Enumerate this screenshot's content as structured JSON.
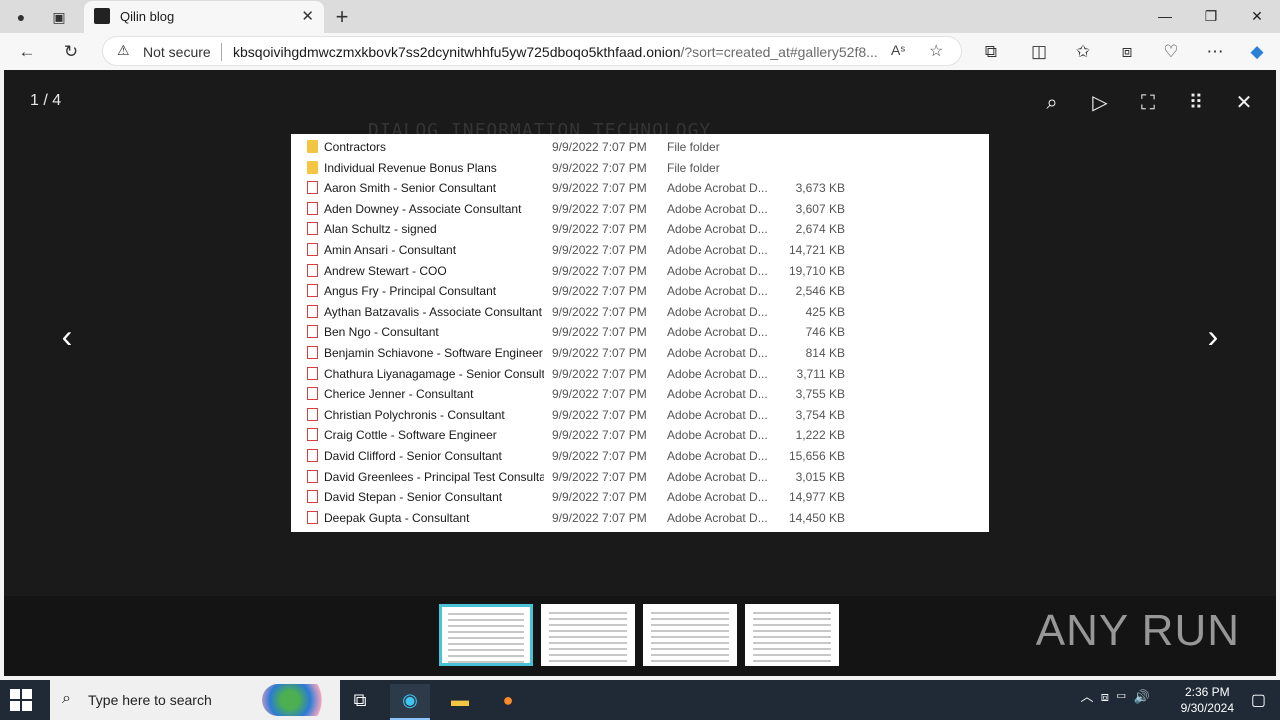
{
  "browser": {
    "tab_title": "Qilin blog",
    "security_label": "Not secure",
    "url_main": "kbsqoivihgdmwczmxkbovk7ss2dcynitwhhfu5yw725dboqo5kthfaad.onion",
    "url_rest": "/?sort=created_at#gallery52f8...",
    "icons": [
      "profile-icon",
      "tab-actions-icon",
      "close-icon",
      "new-tab-icon",
      "minimize-icon",
      "maximize-icon",
      "close-window-icon",
      "back-icon",
      "refresh-icon",
      "warning-icon",
      "read-aloud-icon",
      "favorite-icon",
      "extensions-icon",
      "split-screen-icon",
      "favorites-icon",
      "collections-icon",
      "browser-essentials-icon",
      "more-icon",
      "copilot-icon"
    ]
  },
  "background": {
    "title": "DIALOG INFORMATION TECHNOLOGY"
  },
  "lightbox": {
    "counter": "1 / 4",
    "controls": [
      "zoom-icon",
      "play-icon",
      "fullscreen-icon",
      "grid-icon",
      "close-icon"
    ],
    "files": [
      {
        "name": "Contractors",
        "date": "9/9/2022 7:07 PM",
        "type": "File folder",
        "size": "",
        "icon": "folder"
      },
      {
        "name": "Individual Revenue Bonus Plans",
        "date": "9/9/2022 7:07 PM",
        "type": "File folder",
        "size": "",
        "icon": "folder"
      },
      {
        "name": "Aaron Smith - Senior Consultant",
        "date": "9/9/2022 7:07 PM",
        "type": "Adobe Acrobat D...",
        "size": "3,673 KB",
        "icon": "pdf"
      },
      {
        "name": "Aden Downey - Associate Consultant",
        "date": "9/9/2022 7:07 PM",
        "type": "Adobe Acrobat D...",
        "size": "3,607 KB",
        "icon": "pdf"
      },
      {
        "name": "Alan Schultz - signed",
        "date": "9/9/2022 7:07 PM",
        "type": "Adobe Acrobat D...",
        "size": "2,674 KB",
        "icon": "pdf"
      },
      {
        "name": "Amin Ansari - Consultant",
        "date": "9/9/2022 7:07 PM",
        "type": "Adobe Acrobat D...",
        "size": "14,721 KB",
        "icon": "pdf"
      },
      {
        "name": "Andrew Stewart - COO",
        "date": "9/9/2022 7:07 PM",
        "type": "Adobe Acrobat D...",
        "size": "19,710 KB",
        "icon": "pdf"
      },
      {
        "name": "Angus Fry - Principal Consultant",
        "date": "9/9/2022 7:07 PM",
        "type": "Adobe Acrobat D...",
        "size": "2,546 KB",
        "icon": "pdf"
      },
      {
        "name": "Aythan Batzavalis - Associate Consultant",
        "date": "9/9/2022 7:07 PM",
        "type": "Adobe Acrobat D...",
        "size": "425 KB",
        "icon": "pdf"
      },
      {
        "name": "Ben Ngo - Consultant",
        "date": "9/9/2022 7:07 PM",
        "type": "Adobe Acrobat D...",
        "size": "746 KB",
        "icon": "pdf"
      },
      {
        "name": "Benjamin Schiavone - Software Engineer",
        "date": "9/9/2022 7:07 PM",
        "type": "Adobe Acrobat D...",
        "size": "814 KB",
        "icon": "pdf"
      },
      {
        "name": "Chathura Liyanagamage - Senior Consult...",
        "date": "9/9/2022 7:07 PM",
        "type": "Adobe Acrobat D...",
        "size": "3,711 KB",
        "icon": "pdf"
      },
      {
        "name": "Cherice Jenner - Consultant",
        "date": "9/9/2022 7:07 PM",
        "type": "Adobe Acrobat D...",
        "size": "3,755 KB",
        "icon": "pdf"
      },
      {
        "name": "Christian Polychronis - Consultant",
        "date": "9/9/2022 7:07 PM",
        "type": "Adobe Acrobat D...",
        "size": "3,754 KB",
        "icon": "pdf"
      },
      {
        "name": "Craig Cottle - Software Engineer",
        "date": "9/9/2022 7:07 PM",
        "type": "Adobe Acrobat D...",
        "size": "1,222 KB",
        "icon": "pdf"
      },
      {
        "name": "David Clifford - Senior Consultant",
        "date": "9/9/2022 7:07 PM",
        "type": "Adobe Acrobat D...",
        "size": "15,656 KB",
        "icon": "pdf"
      },
      {
        "name": "David Greenlees - Principal Test Consulta...",
        "date": "9/9/2022 7:07 PM",
        "type": "Adobe Acrobat D...",
        "size": "3,015 KB",
        "icon": "pdf"
      },
      {
        "name": "David Stepan - Senior Consultant",
        "date": "9/9/2022 7:07 PM",
        "type": "Adobe Acrobat D...",
        "size": "14,977 KB",
        "icon": "pdf"
      },
      {
        "name": "Deepak Gupta - Consultant",
        "date": "9/9/2022 7:07 PM",
        "type": "Adobe Acrobat D...",
        "size": "14,450 KB",
        "icon": "pdf"
      }
    ],
    "thumbnail_count": 4,
    "active_thumbnail": 1
  },
  "watermark": "ANY RUN",
  "taskbar": {
    "search_placeholder": "Type here to search",
    "time": "2:36 PM",
    "date": "9/30/2024",
    "apps": [
      "task-view-icon",
      "edge-icon",
      "file-explorer-icon",
      "firefox-icon"
    ]
  },
  "colors": {
    "thumb_active": "#49c2d8",
    "taskbar": "#1f2a36",
    "lightbox_bg": "#1a1a1a"
  }
}
